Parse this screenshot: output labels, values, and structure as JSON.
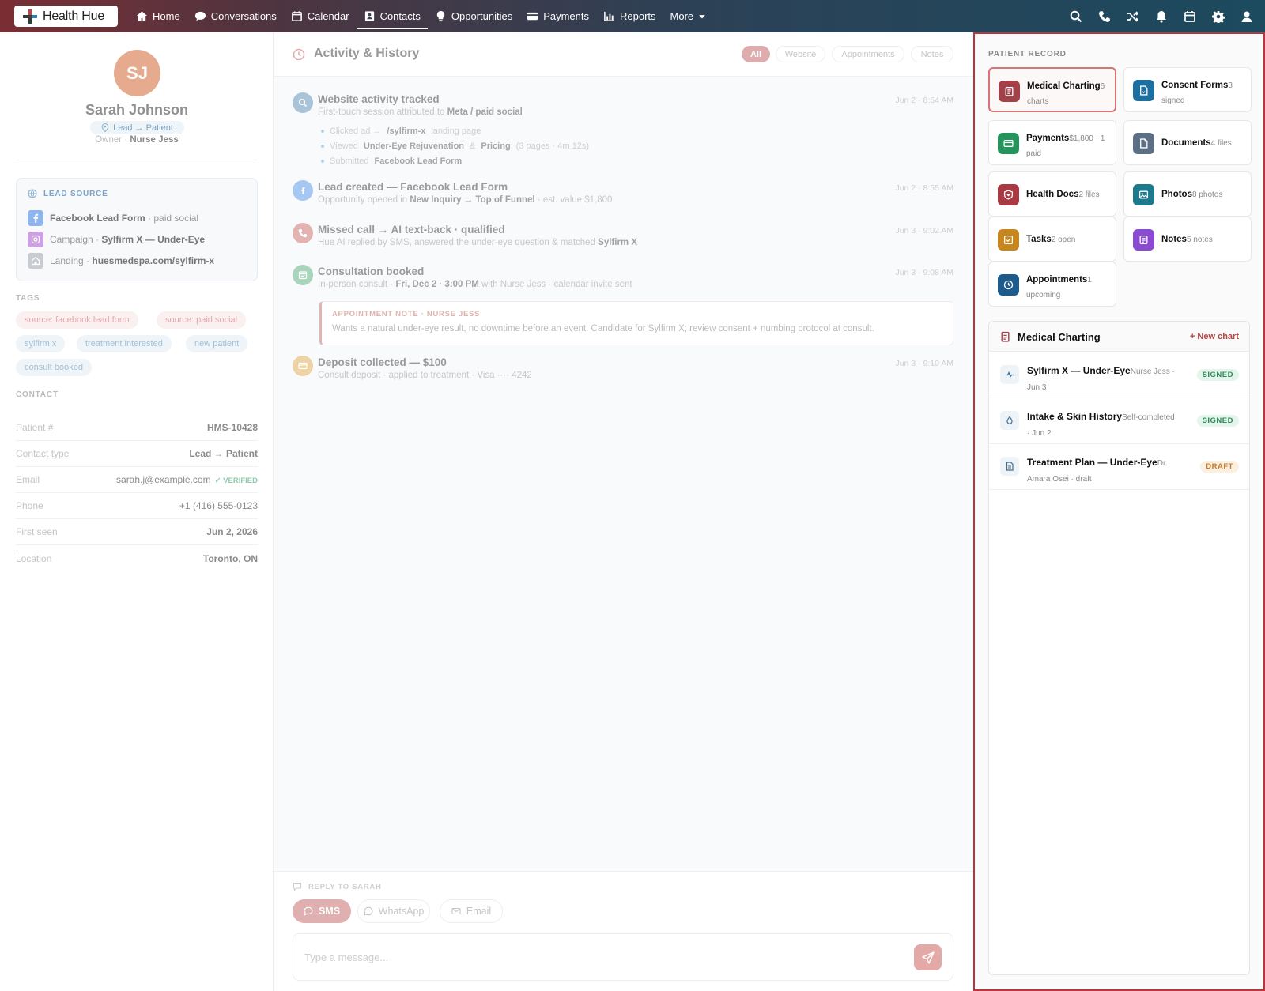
{
  "brand": {
    "name": "Health Hue"
  },
  "nav": {
    "items": [
      {
        "label": "Home",
        "icon": "home-icon"
      },
      {
        "label": "Conversations",
        "icon": "chat-icon"
      },
      {
        "label": "Calendar",
        "icon": "calendar-icon"
      },
      {
        "label": "Contacts",
        "icon": "contact-card-icon",
        "active": true
      },
      {
        "label": "Opportunities",
        "icon": "lightbulb-icon"
      },
      {
        "label": "Payments",
        "icon": "credit-card-icon"
      },
      {
        "label": "Reports",
        "icon": "bar-chart-icon"
      },
      {
        "label": "More",
        "icon": "caret-down-icon"
      }
    ],
    "right_icons": [
      "search-icon",
      "phone-icon",
      "shuffle-icon",
      "bell-icon",
      "calendar-icon",
      "gear-icon",
      "user-icon"
    ]
  },
  "profile": {
    "initials": "SJ",
    "name": "Sarah Johnson",
    "type": "Lead → Patient",
    "owner_label": "Owner ·",
    "owner": "Nurse Jess"
  },
  "lead_source": {
    "title": "LEAD SOURCE",
    "rows": [
      {
        "main": "Facebook Lead Form",
        "rest": " · paid social",
        "prefix": ""
      },
      {
        "prefix": "Campaign · ",
        "main": "Sylfirm X — Under-Eye",
        "rest": ""
      },
      {
        "prefix": "Landing · ",
        "main": "huesmedspa.com/sylfirm-x",
        "rest": ""
      }
    ]
  },
  "tags": {
    "title": "TAGS",
    "items": [
      "source: facebook lead form",
      "source: paid social",
      "sylfirm x",
      "treatment interested",
      "new patient",
      "consult booked"
    ]
  },
  "contact": {
    "title": "CONTACT",
    "rows": [
      {
        "key": "Patient #",
        "value": "HMS-10428"
      },
      {
        "key": "Contact type",
        "value": "Lead → Patient"
      },
      {
        "key": "Email",
        "value": "sarah.j@example.com",
        "verified": "✓ VERIFIED"
      },
      {
        "key": "Phone",
        "value": "+1 (416) 555-0123"
      },
      {
        "key": "First seen",
        "value": "Jun 2, 2026"
      },
      {
        "key": "Location",
        "value": "Toronto, ON"
      }
    ]
  },
  "activity": {
    "title": "Activity & History",
    "filters": [
      "All",
      "Website",
      "Appointments",
      "Notes"
    ],
    "active_filter": "All",
    "events": [
      {
        "title": "Website activity tracked",
        "sub_a": "First-touch session attributed to ",
        "sub_b": "Meta / paid social",
        "sub_c": "",
        "time": "Jun 2 · 8:54 AM",
        "icon": "search-icon",
        "color": "#a9c3d8"
      },
      {
        "title": "Lead created — Facebook Lead Form",
        "sub_a": "Opportunity opened in ",
        "sub_b": "New Inquiry → Top of Funnel",
        "sub_c": " · est. value $1,800",
        "time": "Jun 2 · 8:55 AM",
        "icon": "facebook-icon",
        "color": "#a7c7f3"
      },
      {
        "title": "Missed call → AI text-back · qualified",
        "sub_a": "Hue AI replied by SMS, answered the under-eye question & matched ",
        "sub_b": "Sylfirm X",
        "sub_c": "",
        "time": "Jun 3 · 9:02 AM",
        "icon": "phone-icon",
        "color": "#e3b3b1"
      },
      {
        "title": "Consultation booked",
        "sub_a": "In-person consult · ",
        "sub_b": "Fri, Dec 2 · 3:00 PM",
        "sub_c": " with Nurse Jess · calendar invite sent",
        "time": "Jun 3 · 9:08 AM",
        "icon": "calendar-check-icon",
        "color": "#a9d5bd"
      },
      {
        "title": "Deposit collected — $100",
        "sub_a": "Consult deposit · applied to treatment · Visa ···· 4242",
        "sub_b": "",
        "sub_c": "",
        "time": "Jun 3 · 9:10 AM",
        "icon": "card-icon",
        "color": "#ecd2a5"
      }
    ],
    "website_steps": [
      {
        "a": "Clicked ad →",
        "b": "/sylfirm-x",
        "c": "landing page",
        "d": "",
        "e": ""
      },
      {
        "a": "Viewed",
        "b": "Under-Eye Rejuvenation",
        "c": "&",
        "d": "Pricing",
        "e": "(3 pages · 4m 12s)"
      },
      {
        "a": "Submitted",
        "b": "Facebook Lead Form",
        "c": "",
        "d": "",
        "e": ""
      }
    ],
    "note": {
      "title": "APPOINTMENT NOTE · NURSE JESS",
      "body": "Wants a natural under-eye result, no downtime before an event. Candidate for Sylfirm X; review consent + numbing protocol at consult."
    }
  },
  "reply": {
    "title": "REPLY TO SARAH",
    "channels": [
      "SMS",
      "WhatsApp",
      "Email"
    ],
    "active_channel": "SMS",
    "placeholder": "Type a message..."
  },
  "patient_record": {
    "title": "PATIENT RECORD",
    "cards": [
      {
        "label": "Medical Charting",
        "meta_a": "6",
        "meta_b": "charts",
        "icon": "clipboard-icon",
        "color": "#a3414a",
        "selected": true
      },
      {
        "label": "Consent Forms",
        "meta_a": "3",
        "meta_b": "signed",
        "icon": "document-sign-icon",
        "color": "#1d6f9f"
      },
      {
        "label": "Payments",
        "meta_a": "$1,800 · 1",
        "meta_b": "paid",
        "icon": "credit-card-icon",
        "color": "#24935c"
      },
      {
        "label": "Documents",
        "meta_a": "4 files",
        "meta_b": "",
        "icon": "file-icon",
        "color": "#5d6f84"
      },
      {
        "label": "Health Docs",
        "meta_a": "2 files",
        "meta_b": "",
        "icon": "heart-shield-icon",
        "color": "#a93a43"
      },
      {
        "label": "Photos",
        "meta_a": "8 photos",
        "meta_b": "",
        "icon": "image-icon",
        "color": "#1d7a8c"
      },
      {
        "label": "Tasks",
        "meta_a": "2 open",
        "meta_b": "",
        "icon": "checkbox-icon",
        "color": "#c8861f"
      },
      {
        "label": "Notes",
        "meta_a": "5 notes",
        "meta_b": "",
        "icon": "notes-icon",
        "color": "#8a4ad1"
      },
      {
        "label": "Appointments",
        "meta_a": "1",
        "meta_b": "upcoming",
        "icon": "clock-icon",
        "color": "#1d5b8c"
      }
    ]
  },
  "medical_charting": {
    "title": "Medical Charting",
    "new_label": "+ New chart",
    "rows": [
      {
        "title": "Sylfirm X — Under-Eye",
        "meta_a": "Nurse Jess ·",
        "meta_b": "Jun 3",
        "status": "SIGNED",
        "icon": "pulse-icon"
      },
      {
        "title": "Intake & Skin History",
        "meta_a": "Self-completed",
        "meta_b": "· Jun 2",
        "status": "SIGNED",
        "icon": "droplet-icon"
      },
      {
        "title": "Treatment Plan — Under-Eye",
        "meta_a": "Dr.",
        "meta_b": "Amara Osei · draft",
        "status": "DRAFT",
        "icon": "document-icon"
      }
    ]
  }
}
